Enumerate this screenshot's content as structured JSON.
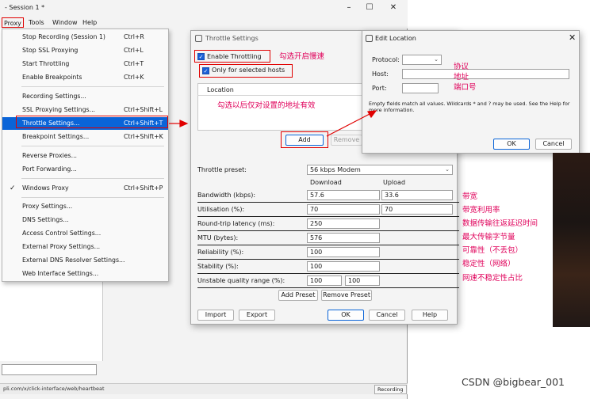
{
  "window": {
    "title": "- Session 1 *",
    "minimize": "–",
    "maximize": "☐",
    "close": "✕"
  },
  "menubar": {
    "proxy": "Proxy",
    "tools": "Tools",
    "window": "Window",
    "help": "Help"
  },
  "proxy_menu": {
    "items": [
      {
        "label": "Stop Recording (Session 1)",
        "shortcut": "Ctrl+R"
      },
      {
        "label": "Stop SSL Proxying",
        "shortcut": "Ctrl+L"
      },
      {
        "label": "Start Throttling",
        "shortcut": "Ctrl+T"
      },
      {
        "label": "Enable Breakpoints",
        "shortcut": "Ctrl+K"
      },
      {
        "label": "Recording Settings...",
        "shortcut": ""
      },
      {
        "label": "SSL Proxying Settings...",
        "shortcut": "Ctrl+Shift+L"
      },
      {
        "label": "Throttle Settings...",
        "shortcut": "Ctrl+Shift+T"
      },
      {
        "label": "Breakpoint Settings...",
        "shortcut": "Ctrl+Shift+K"
      },
      {
        "label": "Reverse Proxies...",
        "shortcut": ""
      },
      {
        "label": "Port Forwarding...",
        "shortcut": ""
      },
      {
        "label": "Windows Proxy",
        "shortcut": "Ctrl+Shift+P",
        "check": "✓"
      },
      {
        "label": "Proxy Settings...",
        "shortcut": ""
      },
      {
        "label": "DNS Settings...",
        "shortcut": ""
      },
      {
        "label": "Access Control Settings...",
        "shortcut": ""
      },
      {
        "label": "External Proxy Settings...",
        "shortcut": ""
      },
      {
        "label": "External DNS Resolver Settings...",
        "shortcut": ""
      },
      {
        "label": "Web Interface Settings...",
        "shortcut": ""
      }
    ]
  },
  "status": {
    "url": "pli.com/x/click-interface/web/heartbeat",
    "recording": "Recording"
  },
  "throttle": {
    "title": "Throttle Settings",
    "enable_label": "Enable Throttling",
    "only_hosts_label": "Only for selected hosts",
    "table_header": "Location",
    "add": "Add",
    "remove": "Remove",
    "preset_label": "Throttle preset:",
    "preset_value": "56 kbps Modem",
    "col_download": "Download",
    "col_upload": "Upload",
    "rows": [
      {
        "label": "Bandwidth (kbps):",
        "download": "57.6",
        "upload": "33.6"
      },
      {
        "label": "Utilisation (%):",
        "download": "70",
        "upload": "70"
      },
      {
        "label": "Round-trip latency (ms):",
        "download": "250"
      },
      {
        "label": "MTU (bytes):",
        "download": "576"
      },
      {
        "label": "Reliability (%):",
        "download": "100"
      },
      {
        "label": "Stability (%):",
        "download": "100"
      },
      {
        "label": "Unstable quality range (%):",
        "download": "100",
        "upload": "100"
      }
    ],
    "add_preset": "Add Preset",
    "remove_preset": "Remove Preset",
    "import": "Import",
    "export": "Export",
    "ok": "OK",
    "cancel": "Cancel",
    "help": "Help"
  },
  "edit_location": {
    "title": "Edit Location",
    "close": "✕",
    "protocol_label": "Protocol:",
    "host_label": "Host:",
    "port_label": "Port:",
    "protocol_value": "",
    "host_value": "",
    "port_value": "",
    "help_text": "Empty fields match all values. Wildcards * and ? may be used. See the Help for more information.",
    "ok": "OK",
    "cancel": "Cancel"
  },
  "annotations": {
    "enable_note": "勾选开启慢速",
    "hosts_note": "勾选以后仅对设置的地址有效",
    "protocol_note": "协议",
    "host_note": "地址",
    "port_note": "端口号",
    "bandwidth_note": "带宽",
    "utilisation_note": "带宽利用率",
    "latency_note": "数据传输往返延迟时间",
    "mtu_note": "最大传输字节量",
    "reliability_note": "可靠性（不丢包）",
    "stability_note": "稳定性（网络）",
    "unstable_note": "网速不稳定性占比"
  },
  "watermark": "CSDN @bigbear_001",
  "colors": {
    "annotation": "#e0005a",
    "highlight_box": "#e00000",
    "menu_selection": "#0a64d8"
  }
}
